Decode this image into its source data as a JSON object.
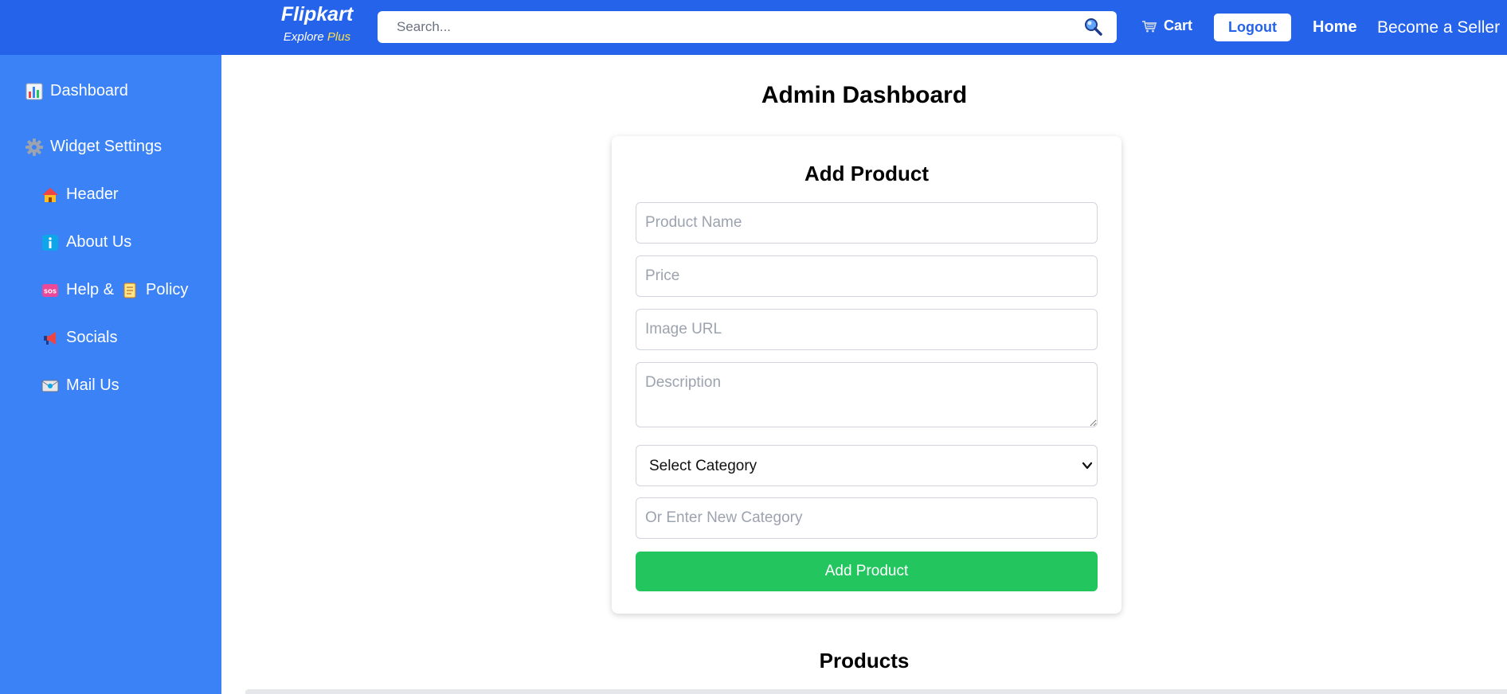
{
  "header": {
    "brand": "Flipkart",
    "tagline": "Explore",
    "tagline_plus": "Plus",
    "search_placeholder": "Search...",
    "cart_label": "Cart",
    "logout_label": "Logout",
    "home_label": "Home",
    "seller_label": "Become a Seller",
    "bg_color": "#2563eb",
    "plus_color": "#fde047"
  },
  "sidebar": {
    "bg_color": "#3b82f6",
    "items": [
      {
        "label": "Dashboard",
        "icon": "bar-chart-icon"
      },
      {
        "label": "Widget Settings",
        "icon": "gear-icon"
      },
      {
        "label": "Header",
        "icon": "house-icon"
      },
      {
        "label": "About Us",
        "icon": "info-icon"
      },
      {
        "label": "Help &",
        "label2": "Policy",
        "icon": "sos-icon",
        "icon2": "scroll-icon"
      },
      {
        "label": "Socials",
        "icon": "megaphone-icon"
      },
      {
        "label": "Mail Us",
        "icon": "email-icon"
      }
    ]
  },
  "main": {
    "page_title": "Admin Dashboard",
    "form": {
      "title": "Add Product",
      "product_name_placeholder": "Product Name",
      "price_placeholder": "Price",
      "image_url_placeholder": "Image URL",
      "description_placeholder": "Description",
      "category_selected": "Select Category",
      "new_category_placeholder": "Or Enter New Category",
      "submit_label": "Add Product",
      "submit_color": "#22c55e"
    },
    "products_title": "Products"
  }
}
